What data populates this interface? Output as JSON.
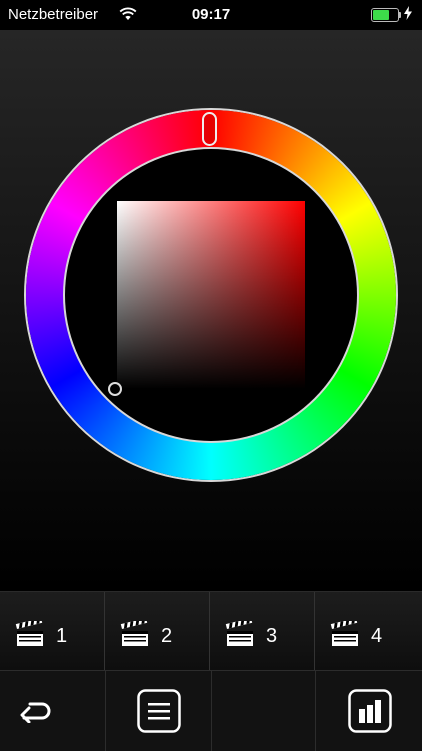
{
  "status_bar": {
    "carrier": "Netzbetreiber",
    "time": "09:17",
    "battery_color": "#3ddc4a"
  },
  "color_picker": {
    "hue_handle_color": "#ff0000"
  },
  "scenes": [
    {
      "label": "1",
      "icon": "clapperboard-icon"
    },
    {
      "label": "2",
      "icon": "clapperboard-icon"
    },
    {
      "label": "3",
      "icon": "clapperboard-icon"
    },
    {
      "label": "4",
      "icon": "clapperboard-icon"
    }
  ],
  "toolbar": {
    "back_icon": "return-arrow-icon",
    "menu_icon": "menu-list-icon",
    "chart_icon": "bar-chart-icon"
  }
}
